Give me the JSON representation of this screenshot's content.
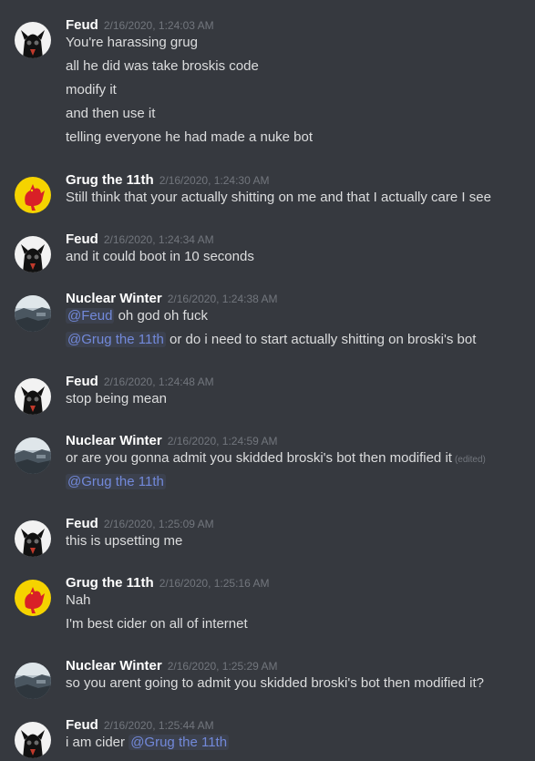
{
  "messages": [
    {
      "author": "Feud",
      "avatar": "feud-avatar-icon",
      "timestamp": "2/16/2020, 1:24:03 AM",
      "lines": [
        {
          "text": "You're harassing grug"
        },
        {
          "text": "all he did was take broskis code"
        },
        {
          "text": "modify it"
        },
        {
          "text": "and then use it"
        },
        {
          "text": "telling everyone he had made a nuke bot"
        }
      ]
    },
    {
      "author": "Grug the 11th",
      "avatar": "rooster-avatar-icon",
      "timestamp": "2/16/2020, 1:24:30 AM",
      "lines": [
        {
          "text": "Still think that your actually shitting on me and that I actually care I see"
        }
      ]
    },
    {
      "author": "Feud",
      "avatar": "feud-avatar-icon",
      "timestamp": "2/16/2020, 1:24:34 AM",
      "lines": [
        {
          "text": "and it could boot in 10 seconds"
        }
      ]
    },
    {
      "author": "Nuclear Winter",
      "avatar": "landscape-avatar-icon",
      "timestamp": "2/16/2020, 1:24:38 AM",
      "lines": [
        {
          "mention": "@Feud",
          "text": "oh god oh fuck"
        },
        {
          "mention": "@Grug the 11th",
          "text": "or do i need to start actually shitting on broski's bot"
        }
      ]
    },
    {
      "author": "Feud",
      "avatar": "feud-avatar-icon",
      "timestamp": "2/16/2020, 1:24:48 AM",
      "lines": [
        {
          "text": "stop being mean"
        }
      ]
    },
    {
      "author": "Nuclear Winter",
      "avatar": "landscape-avatar-icon",
      "timestamp": "2/16/2020, 1:24:59 AM",
      "lines": [
        {
          "text": "or are you gonna admit you skidded broski's bot then modified it",
          "edited": "(edited)"
        },
        {
          "mention": "@Grug the 11th"
        }
      ]
    },
    {
      "author": "Feud",
      "avatar": "feud-avatar-icon",
      "timestamp": "2/16/2020, 1:25:09 AM",
      "lines": [
        {
          "text": "this is upsetting me"
        }
      ]
    },
    {
      "author": "Grug the 11th",
      "avatar": "rooster-avatar-icon",
      "timestamp": "2/16/2020, 1:25:16 AM",
      "lines": [
        {
          "text": "Nah"
        },
        {
          "text": "I'm best cider on all of internet"
        }
      ]
    },
    {
      "author": "Nuclear Winter",
      "avatar": "landscape-avatar-icon",
      "timestamp": "2/16/2020, 1:25:29 AM",
      "lines": [
        {
          "text": "so you arent going to admit you skidded broski's bot then modified it?"
        }
      ]
    },
    {
      "author": "Feud",
      "avatar": "feud-avatar-icon",
      "timestamp": "2/16/2020, 1:25:44 AM",
      "lines": [
        {
          "text": "i am cider",
          "mention_after": "@Grug the 11th"
        }
      ]
    }
  ],
  "colors": {
    "background": "#36393f",
    "username": "#ffffff",
    "timestamp": "#72767d",
    "text": "#dcddde",
    "mention": "#7289da"
  }
}
